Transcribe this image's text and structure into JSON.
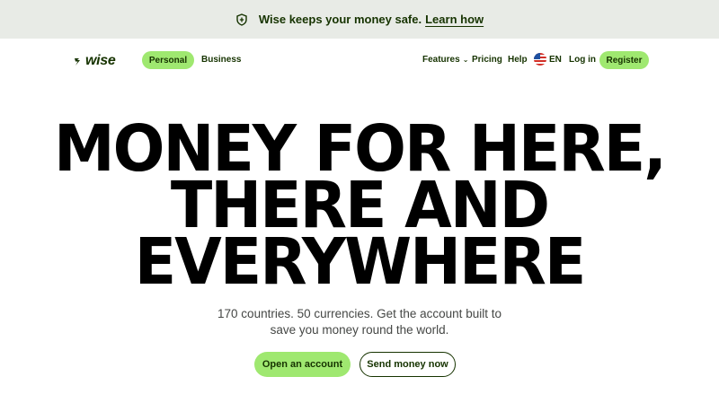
{
  "banner": {
    "text": "Wise keeps your money safe.",
    "link": "Learn how"
  },
  "nav": {
    "logo": "wise",
    "personal": "Personal",
    "business": "Business",
    "features": "Features",
    "pricing": "Pricing",
    "help": "Help",
    "language": "EN",
    "login": "Log in",
    "register": "Register"
  },
  "hero": {
    "line1": "MONEY FOR HERE,",
    "line2": "THERE AND",
    "line3": "EVERYWHERE"
  },
  "subtitle": {
    "line1": "170 countries. 50 currencies. Get the account built to",
    "line2": "save you money round the world."
  },
  "cta": {
    "open_account": "Open an account",
    "send_money": "Send money now"
  },
  "icons": {
    "banner": "shield-icon",
    "logo": "wise-flag-icon",
    "features": "chevron-down-icon",
    "language": "us-flag-icon"
  },
  "colors": {
    "brand_green": "#9fe870",
    "forest": "#163300",
    "banner_bg": "#e8ebe6"
  }
}
